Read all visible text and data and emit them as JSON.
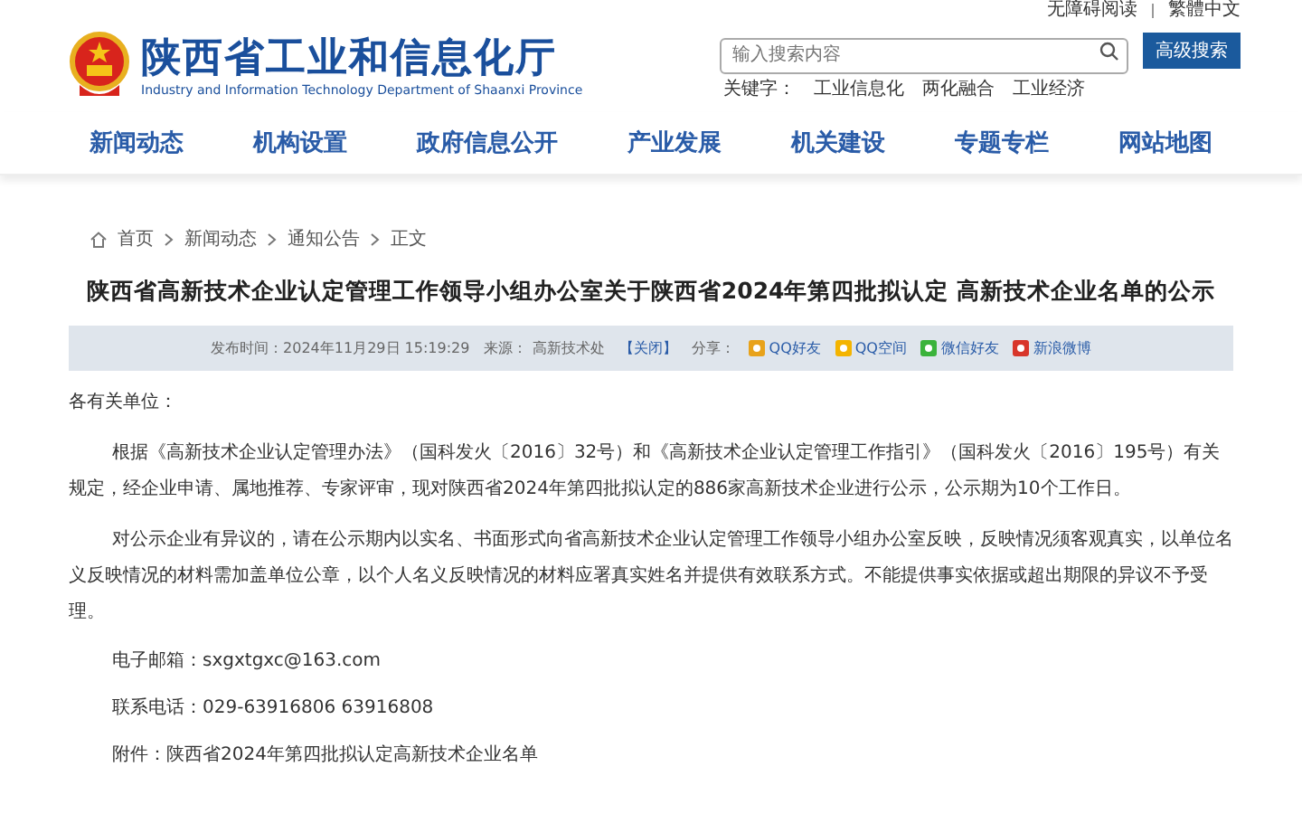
{
  "top_links": [
    "无障碍阅读",
    "繁體中文"
  ],
  "header": {
    "title": "陕西省工业和信息化厅",
    "subtitle": "Industry and Information Technology Department of Shaanxi Province"
  },
  "search": {
    "placeholder": "输入搜索内容",
    "button": "高级搜索",
    "keywords_label": "关键字：",
    "keywords": [
      "工业信息化",
      "两化融合",
      "工业经济"
    ]
  },
  "nav": [
    "新闻动态",
    "机构设置",
    "政府信息公开",
    "产业发展",
    "机关建设",
    "专题专栏",
    "网站地图"
  ],
  "breadcrumb": [
    "首页",
    "新闻动态",
    "通知公告",
    "正文"
  ],
  "article": {
    "title": "陕西省高新技术企业认定管理工作领导小组办公室关于陕西省2024年第四批拟认定 高新技术企业名单的公示",
    "meta": {
      "date": "发布时间：2024年11月29日 15:19:29",
      "source": "来源：  高新技术处",
      "close": "【关闭】",
      "share_label": "分享：",
      "share": [
        {
          "kind": "qq",
          "label": "QQ好友"
        },
        {
          "kind": "qzone",
          "label": "QQ空间"
        },
        {
          "kind": "wechat",
          "label": "微信好友"
        },
        {
          "kind": "weibo",
          "label": "新浪微博"
        }
      ]
    },
    "salutation": "各有关单位：",
    "paragraphs": [
      "根据《高新技术企业认定管理办法》（国科发火〔2016〕32号）和《高新技术企业认定管理工作指引》（国科发火〔2016〕195号）有关规定，经企业申请、属地推荐、专家评审，现对陕西省2024年第四批拟认定的886家高新技术企业进行公示，公示期为10个工作日。",
      "对公示企业有异议的，请在公示期内以实名、书面形式向省高新技术企业认定管理工作领导小组办公室反映，反映情况须客观真实，以单位名义反映情况的材料需加盖单位公章，以个人名义反映情况的材料应署真实姓名并提供有效联系方式。不能提供事实依据或超出期限的异议不予受理。"
    ],
    "contacts": [
      "电子邮箱：sxgxtgxc@163.com",
      "联系电话：029-63916806  63916808",
      "附件：陕西省2024年第四批拟认定高新技术企业名单"
    ]
  }
}
